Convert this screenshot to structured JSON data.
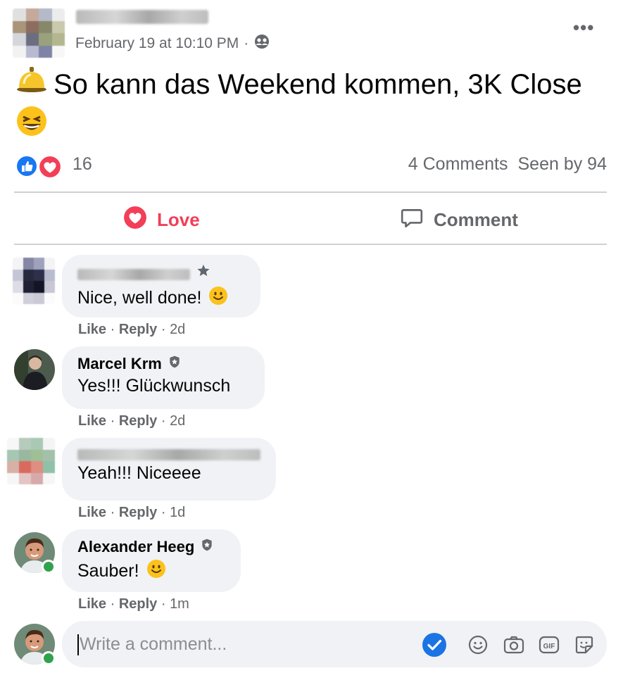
{
  "post": {
    "timestamp": "February 19 at 10:10 PM",
    "separator": "·",
    "audience_icon": "friends-icon",
    "text": "So kann das Weekend kommen, 3K Close",
    "emojis": [
      "bellhop-bell-emoji",
      "grinning-squinting-face-emoji"
    ]
  },
  "reactions": {
    "icons": [
      "like-reaction-icon",
      "love-reaction-icon"
    ],
    "count": "16",
    "comments": "4 Comments",
    "seen": "Seen by 94"
  },
  "actions": {
    "love": "Love",
    "comment": "Comment"
  },
  "comments": [
    {
      "name": "",
      "name_blurred": true,
      "text": "Nice, well done!",
      "emoji": "slightly-smiling-face-emoji",
      "like": "Like",
      "reply": "Reply",
      "time": "2d"
    },
    {
      "name": "Marcel Krm",
      "text": "Yes!!! Glückwunsch",
      "like": "Like",
      "reply": "Reply",
      "time": "2d"
    },
    {
      "name": "",
      "name_blurred": true,
      "text": "Yeah!!! Niceeee",
      "like": "Like",
      "reply": "Reply",
      "time": "1d"
    },
    {
      "name": "Alexander Heeg",
      "text": "Sauber!",
      "emoji": "slightly-smiling-face-emoji",
      "like": "Like",
      "reply": "Reply",
      "time": "1m"
    }
  ],
  "composer": {
    "placeholder": "Write a comment...",
    "icons": [
      "check-badge-icon",
      "emoji-icon",
      "camera-icon",
      "gif-icon",
      "sticker-icon"
    ]
  },
  "colors": {
    "love_red": "#f33e58",
    "like_blue": "#1877f2",
    "secondary_text": "#65676b",
    "bubble_bg": "#f0f2f5",
    "online_green": "#31a24c"
  }
}
